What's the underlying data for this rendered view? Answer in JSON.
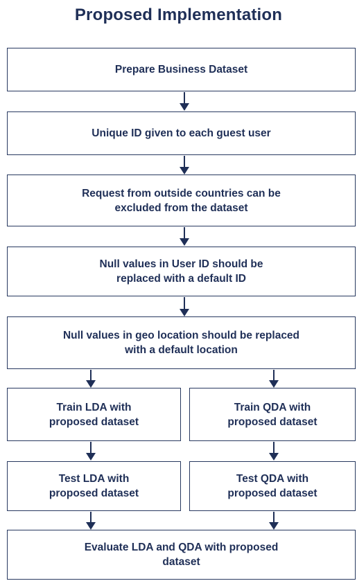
{
  "title": "Proposed Implementation",
  "steps": {
    "prepare": "Prepare Business Dataset",
    "unique_id": "Unique ID given to each guest user",
    "exclude_requests": "Request from outside countries can be excluded from the dataset",
    "null_user_id": "Null values in User ID should be replaced with a default ID",
    "null_geo": "Null values in geo location should be replaced with a default location",
    "train_lda": "Train LDA with proposed dataset",
    "train_qda": "Train QDA with proposed dataset",
    "test_lda": "Test LDA with proposed dataset",
    "test_qda": "Test QDA with proposed dataset",
    "evaluate": "Evaluate LDA and QDA with proposed dataset"
  },
  "colors": {
    "text": "#1f2f57",
    "border": "#27385f",
    "background": "#ffffff"
  }
}
